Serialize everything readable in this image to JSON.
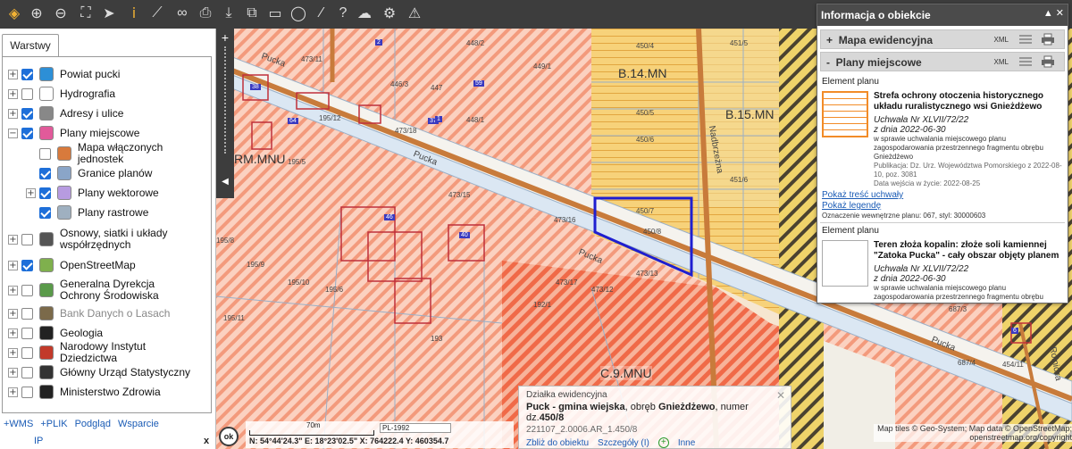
{
  "toolbar": {
    "icons": [
      "layers-icon",
      "zoom-in-icon",
      "zoom-out-icon",
      "zoom-extent-icon",
      "pointer-icon",
      "info-icon",
      "measure-icon",
      "link-icon",
      "print-icon",
      "download-icon",
      "export-icon",
      "window-icon",
      "comment-icon",
      "draw-icon",
      "help-icon",
      "cloud-icon",
      "settings-icon",
      "warning-icon"
    ],
    "help_glyph": "?",
    "info_glyph": "i"
  },
  "left_panel": {
    "tab_label": "Warstwy",
    "layers": [
      {
        "label": "Powiat pucki",
        "checked": true,
        "expand": "+",
        "icon": "coat-of-arms-icon",
        "indent": 0
      },
      {
        "label": "Hydrografia",
        "checked": false,
        "expand": "+",
        "icon": "water-icon",
        "indent": 0
      },
      {
        "label": "Adresy i ulice",
        "checked": true,
        "expand": "+",
        "icon": "mail-icon",
        "indent": 0
      },
      {
        "label": "Plany miejscowe",
        "checked": true,
        "expand": "−",
        "icon": "plan-icon",
        "indent": 0
      },
      {
        "label": "Mapa włączonych jednostek",
        "checked": false,
        "expand": "",
        "icon": "map-units-icon",
        "indent": 1
      },
      {
        "label": "Granice planów",
        "checked": true,
        "expand": "",
        "icon": "boundaries-icon",
        "indent": 1
      },
      {
        "label": "Plany wektorowe",
        "checked": true,
        "expand": "+",
        "icon": "vector-plans-icon",
        "indent": 1
      },
      {
        "label": "Plany rastrowe",
        "checked": true,
        "expand": "",
        "icon": "raster-plans-icon",
        "indent": 1
      },
      {
        "label": "Osnowy, siatki i układy współrzędnych",
        "checked": false,
        "expand": "+",
        "icon": "globe-icon",
        "indent": 0
      },
      {
        "label": "OpenStreetMap",
        "checked": true,
        "expand": "+",
        "icon": "osm-icon",
        "indent": 0
      },
      {
        "label": "Generalna Dyrekcja Ochrony Środowiska",
        "checked": false,
        "expand": "+",
        "icon": "leaf-icon",
        "indent": 0
      },
      {
        "label": "Bank Danych o Lasach",
        "checked": false,
        "expand": "+",
        "icon": "forest-icon",
        "indent": 0,
        "grey": true
      },
      {
        "label": "Geologia",
        "checked": false,
        "expand": "+",
        "icon": "hammers-icon",
        "indent": 0
      },
      {
        "label": "Narodowy Instytut Dziedzictwa",
        "checked": false,
        "expand": "+",
        "icon": "heritage-icon",
        "indent": 0
      },
      {
        "label": "Główny Urząd Statystyczny",
        "checked": false,
        "expand": "+",
        "icon": "stats-icon",
        "indent": 0
      },
      {
        "label": "Ministerstwo Zdrowia",
        "checked": false,
        "expand": "+",
        "icon": "health-icon",
        "indent": 0
      }
    ],
    "bottom_links": [
      "+WMS",
      "+PLIK",
      "Podgląd",
      "Wsparcie"
    ],
    "bottom_links2": [
      "IP"
    ],
    "close_label": "x"
  },
  "map": {
    "zone_labels": [
      "B.14.MN",
      "B.15.MN",
      "RM.MNU",
      "C.9.MNU"
    ],
    "street_labels": [
      "Pucka",
      "Pucka",
      "Pucka",
      "Pucka",
      "Nadbrzeżna",
      "Rolnicza"
    ],
    "parcel_labels": [
      "473/11",
      "448/2",
      "449/1",
      "450/4",
      "451/5",
      "446/3",
      "447",
      "448/1",
      "195/12",
      "473/18",
      "450/5",
      "450/6",
      "195/5",
      "451/6",
      "473/15",
      "473/16",
      "450/7",
      "450/8",
      "195/8",
      "195/9",
      "195/10",
      "195/6",
      "473/17",
      "473/12",
      "195/11",
      "192/1",
      "193",
      "687/3",
      "687/4",
      "454/11",
      "473/13"
    ],
    "building_numbers": [
      "38",
      "64",
      "2",
      "59",
      "37",
      "46",
      "40",
      "6",
      "1"
    ],
    "zoom_in": "+",
    "zoom_out": "−",
    "collapse_glyph": "◀"
  },
  "info_panel": {
    "title": "Informacja o obiekcie",
    "header_controls": "▲ ✕",
    "sections": [
      {
        "toggle": "+",
        "label": "Mapa ewidencyjna",
        "xml": "XML"
      },
      {
        "toggle": "-",
        "label": "Plany miejscowe",
        "xml": "XML"
      }
    ],
    "element_label": "Element planu",
    "elements": [
      {
        "title": "Strefa ochrony otoczenia historycznego układu ruralistycznego wsi Gnieżdżewo",
        "resolution": "Uchwała Nr XLVII/72/22",
        "date": "z dnia 2022-06-30",
        "desc": "w sprawie uchwalania miejscowego planu zagospodarowania przestrzennego fragmentu obrębu Gnieżdżewo",
        "publication": "Publikacja: Dz. Urz. Województwa Pomorskiego z 2022-08-10, poz. 3081",
        "effective": "Data wejścia w życie: 2022-08-25",
        "swatch": "#f28c28"
      },
      {
        "title": "Teren złoża kopalin: złoże soli kamiennej \"Zatoka Pucka\" - cały obszar objęty planem",
        "resolution": "Uchwała Nr XLVII/72/22",
        "date": "z dnia 2022-06-30",
        "desc": "w sprawie uchwalania miejscowego planu zagospodarowania przestrzennego fragmentu obrębu",
        "swatch": "#ffffff"
      }
    ],
    "link_show": "Pokaż treść uchwały",
    "link_legend": "Pokaż legendę",
    "designation": "Oznaczenie wewnętrzne planu: 067, styl: 30000603"
  },
  "parcel_popup": {
    "heading": "Działka ewidencyjna",
    "text_prefix": "Puck - gmina wiejska",
    "text_mid": ", obręb ",
    "obreb": "Gnieżdżewo",
    "text_num": ", numer dz.",
    "number": "450/8",
    "identifier": "221107_2.0006.AR_1.450/8",
    "actions": [
      "Zbliż do obiektu",
      "Szczegóły (I)",
      "Inne"
    ],
    "close": "✕"
  },
  "status": {
    "ok_label": "ok",
    "scale_label": "70m",
    "crs": "PL-1992",
    "coords": "N: 54°44'24.3\"  E: 18°23'02.5\"  X: 764222.4  Y: 460354.7",
    "attribution": "Map tiles © Geo-System; Map data © OpenStreetMap; openstreetmap.org/copyright"
  }
}
